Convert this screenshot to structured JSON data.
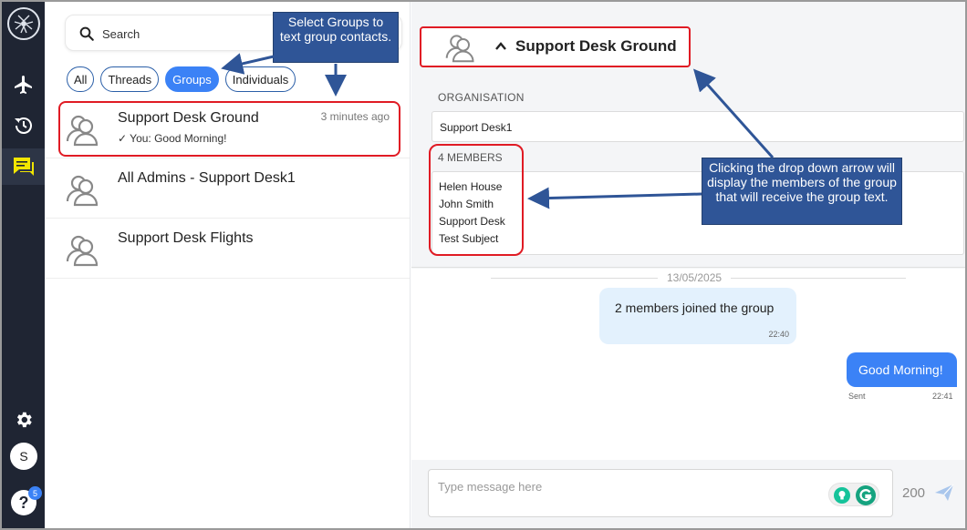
{
  "sidebar": {
    "nav_items": [
      {
        "icon": "airplane-icon"
      },
      {
        "icon": "history-icon"
      },
      {
        "icon": "chat-icon",
        "active": true
      }
    ],
    "avatar_initial": "S",
    "help_label": "?",
    "help_badge": "5"
  },
  "search": {
    "placeholder": "Search"
  },
  "filters": {
    "items": [
      "All",
      "Threads",
      "Groups",
      "Individuals"
    ],
    "active": "Groups"
  },
  "conversations": [
    {
      "name": "Support Desk Ground",
      "time": "3 minutes ago",
      "preview": "✓ You: Good Morning!",
      "selected": true
    },
    {
      "name": "All Admins - Support Desk1",
      "time": "",
      "preview": ""
    },
    {
      "name": "Support Desk Flights",
      "time": "",
      "preview": ""
    }
  ],
  "header": {
    "title": "Support Desk Ground"
  },
  "details": {
    "organisation_label": "ORGANISATION",
    "organisation_value": "Support Desk1",
    "members_label": "4 MEMBERS",
    "members": [
      "Helen House",
      "John Smith",
      "Support Desk",
      "Test Subject"
    ]
  },
  "chat": {
    "date": "13/05/2025",
    "incoming": {
      "text": "2 members joined the group",
      "time": "22:40"
    },
    "outgoing": {
      "text": "Good Morning!",
      "status": "Sent",
      "time": "22:41"
    }
  },
  "composer": {
    "placeholder": "Type message here",
    "counter": "200"
  },
  "callouts": {
    "groups": "Select Groups to text group contacts.",
    "members": "Clicking the drop down arrow will display the members of the group that will receive the group text."
  },
  "colors": {
    "sidebar_bg": "#1f2533",
    "accent": "#3b82f6",
    "callout_bg": "#2f5597",
    "highlight_red": "#e01b24",
    "chat_icon": "#f2e600"
  }
}
